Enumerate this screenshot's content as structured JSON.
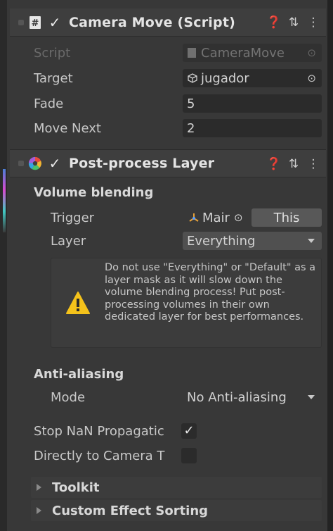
{
  "camera_move": {
    "title": "Camera Move (Script)",
    "enabled": "✓",
    "fields": {
      "script_label": "Script",
      "script_value": "CameraMove",
      "target_label": "Target",
      "target_value": "jugador",
      "fade_label": "Fade",
      "fade_value": "5",
      "move_next_label": "Move Next",
      "move_next_value": "2"
    }
  },
  "post_process_layer": {
    "title": "Post-process Layer",
    "enabled": "✓",
    "volume_blending": {
      "section_label": "Volume blending",
      "trigger_label": "Trigger",
      "trigger_value": "Mair",
      "this_button": "This",
      "layer_label": "Layer",
      "layer_value": "Everything",
      "warning": "Do not use \"Everything\" or \"Default\" as a layer mask as it will slow down the volume blending process! Put post-processing volumes in their own dedicated layer for best performances."
    },
    "anti_aliasing": {
      "section_label": "Anti-aliasing",
      "mode_label": "Mode",
      "mode_value": "No Anti-aliasing"
    },
    "stop_nan_label": "Stop NaN Propagatic",
    "stop_nan_check": "✓",
    "directly_label": "Directly to Camera T",
    "toolkit_label": "Toolkit",
    "custom_sorting_label": "Custom Effect Sorting"
  },
  "icons": {
    "help": "help-icon",
    "presets": "presets-icon",
    "menu": "kebab-menu-icon",
    "object_picker": "object-picker-icon",
    "warning": "warning-icon"
  },
  "colors": {
    "background": "#383838",
    "header": "#3e3e3e",
    "field": "#2b2b2b",
    "warning_yellow": "#f4c21b"
  }
}
